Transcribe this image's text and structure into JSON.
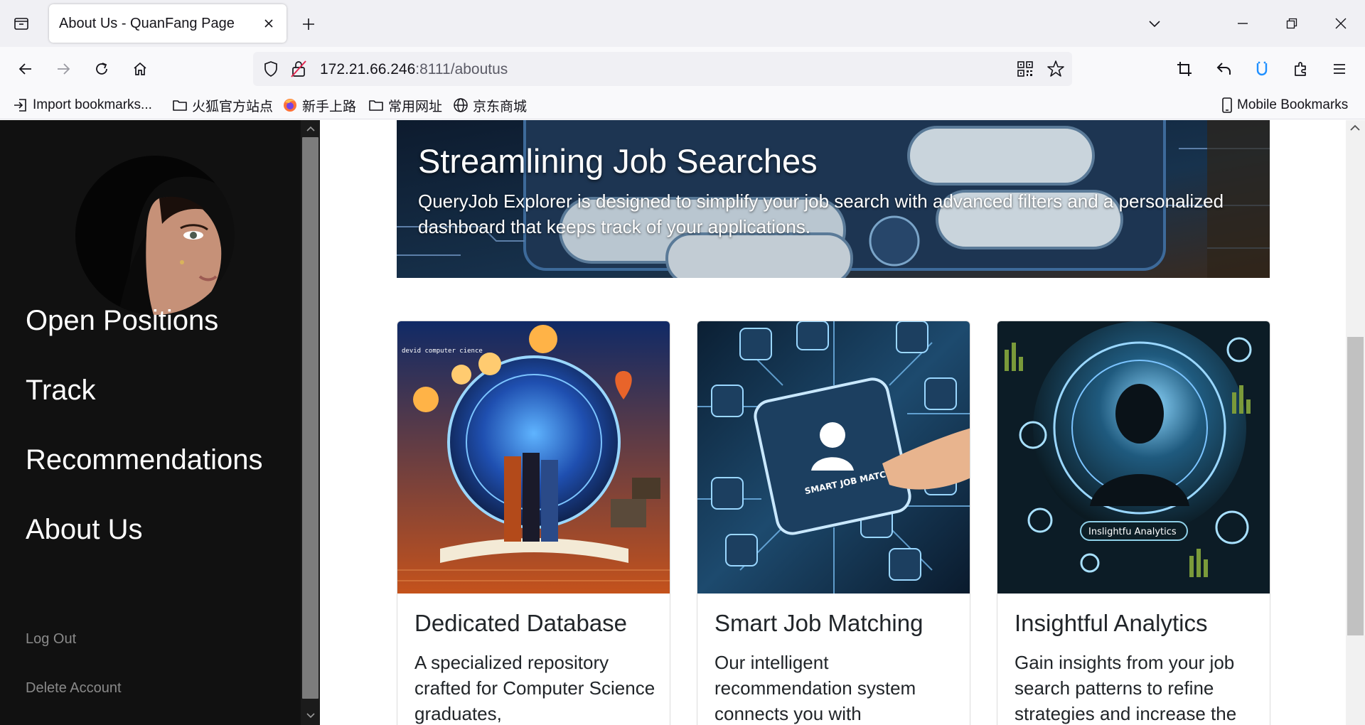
{
  "browser": {
    "tab_title": "About Us - QuanFang Page",
    "url_host": "172.21.66.246",
    "url_rest": ":8111/aboutus",
    "bookmarks": [
      {
        "label": "Import bookmarks...",
        "icon": "import-icon"
      },
      {
        "label": "火狐官方站点",
        "icon": "folder-icon"
      },
      {
        "label": "新手上路",
        "icon": "firefox-icon"
      },
      {
        "label": "常用网址",
        "icon": "folder-icon"
      },
      {
        "label": "京东商城",
        "icon": "globe-icon"
      }
    ],
    "mobile_bookmarks": "Mobile Bookmarks"
  },
  "sidebar": {
    "nav": [
      "Open Positions",
      "Track",
      "Recommendations",
      "About Us"
    ],
    "secondary": [
      "Log Out",
      "Delete Account"
    ]
  },
  "banner": {
    "title": "Streamlining Job Searches",
    "text": "QueryJob Explorer is designed to simplify your job search with advanced filters and a personalized dashboard that keeps track of your applications."
  },
  "cards": [
    {
      "title": "Dedicated Database",
      "text": "A specialized repository crafted for Computer Science graduates,",
      "image_labels": [
        "devid computer cience"
      ]
    },
    {
      "title": "Smart Job Matching",
      "text": "Our intelligent recommendation system connects you with",
      "image_labels": [
        "SMART JOB MATCHING"
      ]
    },
    {
      "title": "Insightful Analytics",
      "text": "Gain insights from your job search patterns to refine strategies and increase the",
      "image_labels": [
        "Inslightfu Analytics"
      ]
    }
  ],
  "colors": {
    "sidebar_bg": "#111111",
    "chrome_bg": "#f0f0f4",
    "accent": "#1f8fff"
  }
}
